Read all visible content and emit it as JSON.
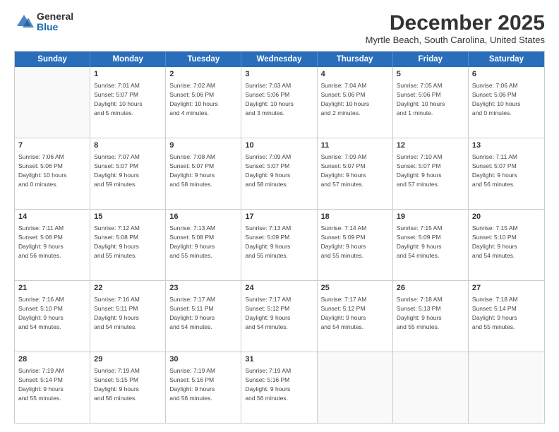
{
  "logo": {
    "general": "General",
    "blue": "Blue"
  },
  "title": "December 2025",
  "location": "Myrtle Beach, South Carolina, United States",
  "calendar": {
    "headers": [
      "Sunday",
      "Monday",
      "Tuesday",
      "Wednesday",
      "Thursday",
      "Friday",
      "Saturday"
    ],
    "rows": [
      [
        {
          "day": "",
          "text": ""
        },
        {
          "day": "1",
          "text": "Sunrise: 7:01 AM\nSunset: 5:07 PM\nDaylight: 10 hours\nand 5 minutes."
        },
        {
          "day": "2",
          "text": "Sunrise: 7:02 AM\nSunset: 5:06 PM\nDaylight: 10 hours\nand 4 minutes."
        },
        {
          "day": "3",
          "text": "Sunrise: 7:03 AM\nSunset: 5:06 PM\nDaylight: 10 hours\nand 3 minutes."
        },
        {
          "day": "4",
          "text": "Sunrise: 7:04 AM\nSunset: 5:06 PM\nDaylight: 10 hours\nand 2 minutes."
        },
        {
          "day": "5",
          "text": "Sunrise: 7:05 AM\nSunset: 5:06 PM\nDaylight: 10 hours\nand 1 minute."
        },
        {
          "day": "6",
          "text": "Sunrise: 7:06 AM\nSunset: 5:06 PM\nDaylight: 10 hours\nand 0 minutes."
        }
      ],
      [
        {
          "day": "7",
          "text": "Sunrise: 7:06 AM\nSunset: 5:06 PM\nDaylight: 10 hours\nand 0 minutes."
        },
        {
          "day": "8",
          "text": "Sunrise: 7:07 AM\nSunset: 5:07 PM\nDaylight: 9 hours\nand 59 minutes."
        },
        {
          "day": "9",
          "text": "Sunrise: 7:08 AM\nSunset: 5:07 PM\nDaylight: 9 hours\nand 58 minutes."
        },
        {
          "day": "10",
          "text": "Sunrise: 7:09 AM\nSunset: 5:07 PM\nDaylight: 9 hours\nand 58 minutes."
        },
        {
          "day": "11",
          "text": "Sunrise: 7:09 AM\nSunset: 5:07 PM\nDaylight: 9 hours\nand 57 minutes."
        },
        {
          "day": "12",
          "text": "Sunrise: 7:10 AM\nSunset: 5:07 PM\nDaylight: 9 hours\nand 57 minutes."
        },
        {
          "day": "13",
          "text": "Sunrise: 7:11 AM\nSunset: 5:07 PM\nDaylight: 9 hours\nand 56 minutes."
        }
      ],
      [
        {
          "day": "14",
          "text": "Sunrise: 7:11 AM\nSunset: 5:08 PM\nDaylight: 9 hours\nand 56 minutes."
        },
        {
          "day": "15",
          "text": "Sunrise: 7:12 AM\nSunset: 5:08 PM\nDaylight: 9 hours\nand 55 minutes."
        },
        {
          "day": "16",
          "text": "Sunrise: 7:13 AM\nSunset: 5:08 PM\nDaylight: 9 hours\nand 55 minutes."
        },
        {
          "day": "17",
          "text": "Sunrise: 7:13 AM\nSunset: 5:09 PM\nDaylight: 9 hours\nand 55 minutes."
        },
        {
          "day": "18",
          "text": "Sunrise: 7:14 AM\nSunset: 5:09 PM\nDaylight: 9 hours\nand 55 minutes."
        },
        {
          "day": "19",
          "text": "Sunrise: 7:15 AM\nSunset: 5:09 PM\nDaylight: 9 hours\nand 54 minutes."
        },
        {
          "day": "20",
          "text": "Sunrise: 7:15 AM\nSunset: 5:10 PM\nDaylight: 9 hours\nand 54 minutes."
        }
      ],
      [
        {
          "day": "21",
          "text": "Sunrise: 7:16 AM\nSunset: 5:10 PM\nDaylight: 9 hours\nand 54 minutes."
        },
        {
          "day": "22",
          "text": "Sunrise: 7:16 AM\nSunset: 5:11 PM\nDaylight: 9 hours\nand 54 minutes."
        },
        {
          "day": "23",
          "text": "Sunrise: 7:17 AM\nSunset: 5:11 PM\nDaylight: 9 hours\nand 54 minutes."
        },
        {
          "day": "24",
          "text": "Sunrise: 7:17 AM\nSunset: 5:12 PM\nDaylight: 9 hours\nand 54 minutes."
        },
        {
          "day": "25",
          "text": "Sunrise: 7:17 AM\nSunset: 5:12 PM\nDaylight: 9 hours\nand 54 minutes."
        },
        {
          "day": "26",
          "text": "Sunrise: 7:18 AM\nSunset: 5:13 PM\nDaylight: 9 hours\nand 55 minutes."
        },
        {
          "day": "27",
          "text": "Sunrise: 7:18 AM\nSunset: 5:14 PM\nDaylight: 9 hours\nand 55 minutes."
        }
      ],
      [
        {
          "day": "28",
          "text": "Sunrise: 7:19 AM\nSunset: 5:14 PM\nDaylight: 9 hours\nand 55 minutes."
        },
        {
          "day": "29",
          "text": "Sunrise: 7:19 AM\nSunset: 5:15 PM\nDaylight: 9 hours\nand 56 minutes."
        },
        {
          "day": "30",
          "text": "Sunrise: 7:19 AM\nSunset: 5:16 PM\nDaylight: 9 hours\nand 56 minutes."
        },
        {
          "day": "31",
          "text": "Sunrise: 7:19 AM\nSunset: 5:16 PM\nDaylight: 9 hours\nand 56 minutes."
        },
        {
          "day": "",
          "text": ""
        },
        {
          "day": "",
          "text": ""
        },
        {
          "day": "",
          "text": ""
        }
      ]
    ]
  }
}
